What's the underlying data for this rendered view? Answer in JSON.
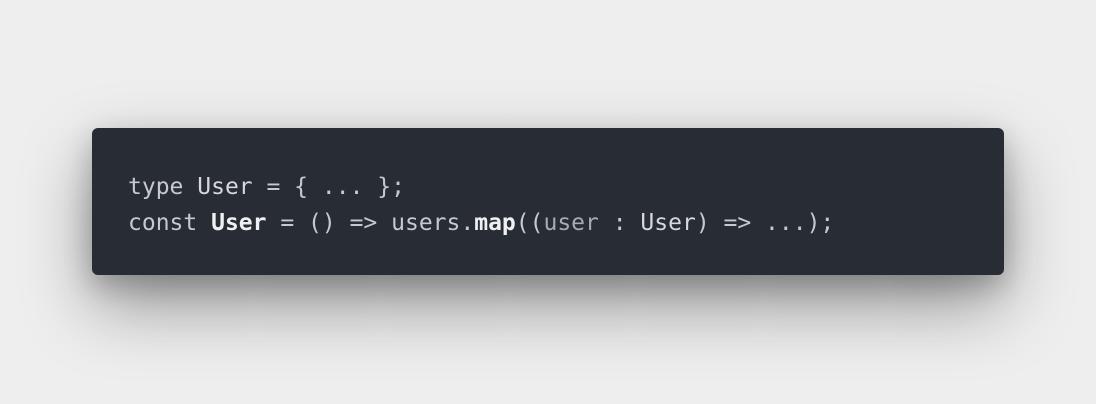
{
  "snippet": {
    "line1": {
      "keyword": "type",
      "space1": " ",
      "type_name": "User",
      "rest": " = { ... };"
    },
    "line2": {
      "keyword": "const",
      "space1": " ",
      "const_name": "User",
      "middle": " = () => ",
      "object": "users",
      "dot": ".",
      "method": "map",
      "open_parens": "((",
      "param": "user",
      "colon": " : ",
      "param_type": "User",
      "end": ") => ...);"
    }
  }
}
